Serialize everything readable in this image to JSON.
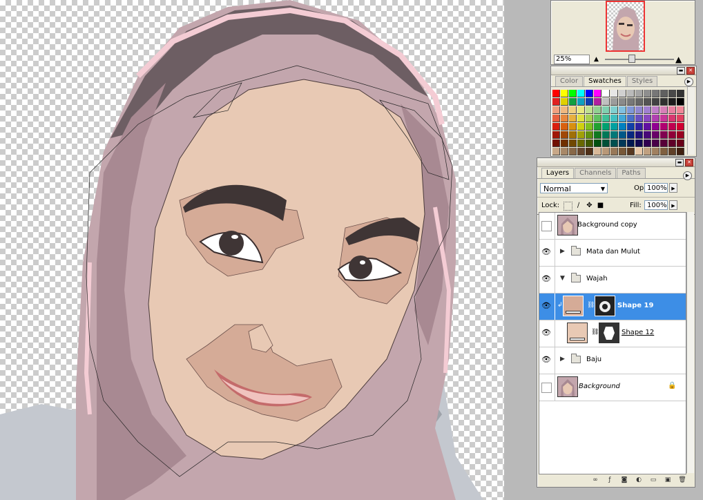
{
  "navigator": {
    "zoom": "25%"
  },
  "swatches": {
    "tabs": [
      {
        "label": "Color",
        "active": false
      },
      {
        "label": "Swatches",
        "active": true
      },
      {
        "label": "Styles",
        "active": false
      }
    ],
    "rows": [
      [
        "#ff0000",
        "#ffff00",
        "#00ff00",
        "#00ffff",
        "#0000ff",
        "#ff00ff",
        "#ffffff",
        "#e6e6e6",
        "#d0d0d0",
        "#bababa",
        "#a5a5a5",
        "#8e8e8e",
        "#777777",
        "#606060",
        "#494949",
        "#333333"
      ],
      [
        "#e02020",
        "#e0d000",
        "#10a040",
        "#10a0c0",
        "#1040b0",
        "#b020a0",
        "#c0c0c0",
        "#9c9c9c",
        "#8a8a8a",
        "#787878",
        "#666666",
        "#545454",
        "#424242",
        "#303030",
        "#1c1c1c",
        "#000000"
      ],
      [
        "#f0a080",
        "#f0b880",
        "#f0d080",
        "#e8e880",
        "#c0e090",
        "#90d090",
        "#80d0b0",
        "#80d0d0",
        "#80c0e0",
        "#8098d8",
        "#9088d0",
        "#a080d0",
        "#c080c8",
        "#d880b8",
        "#e880a0",
        "#f08898"
      ],
      [
        "#e86040",
        "#e88840",
        "#e8b040",
        "#e0e040",
        "#a8d050",
        "#60c060",
        "#40c098",
        "#40c0c0",
        "#40a8d8",
        "#4870c8",
        "#6850c0",
        "#8848c0",
        "#b040b0",
        "#c83898",
        "#d83870",
        "#e04060"
      ],
      [
        "#d82010",
        "#d86010",
        "#d89010",
        "#d0d010",
        "#80c020",
        "#20a030",
        "#00a070",
        "#00a0a0",
        "#0080c0",
        "#1040a8",
        "#3020a0",
        "#6010a0",
        "#900090",
        "#b00070",
        "#c00050",
        "#d00030"
      ],
      [
        "#a01808",
        "#a04808",
        "#a07008",
        "#a0a008",
        "#609010",
        "#107820",
        "#007858",
        "#007878",
        "#005888",
        "#082880",
        "#201078",
        "#480878",
        "#680068",
        "#800050",
        "#900038",
        "#980020"
      ],
      [
        "#701000",
        "#703000",
        "#704800",
        "#686800",
        "#405800",
        "#005010",
        "#005038",
        "#005050",
        "#003858",
        "#001850",
        "#100850",
        "#300050",
        "#480048",
        "#580038",
        "#600028",
        "#680018"
      ],
      [
        "#c8a888",
        "#a88868",
        "#886848",
        "#684830",
        "#503018",
        "#d8b898",
        "#b89878",
        "#987858",
        "#785838",
        "#583820",
        "#e8c8a8",
        "#c0a080",
        "#a08060",
        "#806040",
        "#604028",
        "#402010"
      ]
    ]
  },
  "layers": {
    "tabs": [
      {
        "label": "Layers",
        "active": true
      },
      {
        "label": "Channels",
        "active": false
      },
      {
        "label": "Paths",
        "active": false
      }
    ],
    "blend_mode": "Normal",
    "opacity_label": "Opacity:",
    "opacity": "100%",
    "lock_label": "Lock:",
    "fill_label": "Fill:",
    "fill": "100%",
    "items": [
      {
        "name": "Background copy",
        "visible": false,
        "kind": "image"
      },
      {
        "name": "Mata dan Mulut",
        "visible": true,
        "kind": "group",
        "expanded": false
      },
      {
        "name": "Wajah",
        "visible": true,
        "kind": "group",
        "expanded": true
      },
      {
        "name": "Shape 19",
        "visible": true,
        "kind": "shape",
        "selected": true
      },
      {
        "name": "Shape 12",
        "visible": true,
        "kind": "shape"
      },
      {
        "name": "Baju",
        "visible": true,
        "kind": "group",
        "expanded": false
      },
      {
        "name": "Background",
        "visible": false,
        "kind": "image",
        "locked": true
      }
    ]
  }
}
